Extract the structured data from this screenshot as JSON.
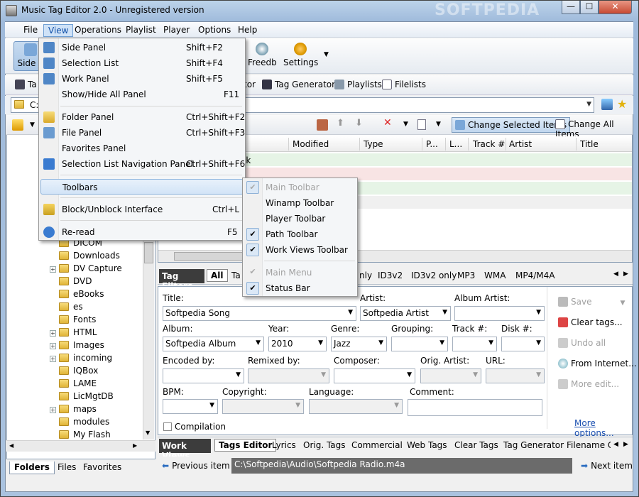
{
  "window": {
    "title": "Music Tag Editor 2.0 - Unregistered version",
    "watermark": "SOFTPEDIA",
    "controls": {
      "minimize": "—",
      "maximize": "☐",
      "close": "✕"
    }
  },
  "menubar": [
    "File",
    "View",
    "Operations",
    "Playlist",
    "Player",
    "Options",
    "Help"
  ],
  "toolbar": {
    "side_panel": "Side P",
    "freedb": "Freedb",
    "settings": "Settings"
  },
  "toolbar2": {
    "ta": "Ta",
    "tor": "tor",
    "tag_generator": "Tag Generator",
    "playlists": "Playlists",
    "filelists": "Filelists"
  },
  "path": {
    "value": "C:"
  },
  "right_toolbar": {
    "change_selected": "Change Selected Items",
    "change_all": "Change All Items"
  },
  "columns": [
    "Modified",
    "Type",
    "P...",
    "L...",
    "Track #",
    "Artist",
    "Title"
  ],
  "list": {
    "partial_text": "ok"
  },
  "folders": [
    "DICOM",
    "Downloads",
    "DV Capture",
    "DVD",
    "eBooks",
    "es",
    "Fonts",
    "HTML",
    "Images",
    "incoming",
    "IQBox",
    "LAME",
    "LicMgtDB",
    "maps",
    "modules",
    "My Flash"
  ],
  "left_tabs": [
    "Folders",
    "Files",
    "Favorites"
  ],
  "filters": {
    "label": "Tag Filters",
    "tabs": [
      "All",
      "Ta",
      "nly",
      "ID3v2",
      "ID3v2 only",
      "MP3",
      "WMA",
      "MP4/M4A"
    ]
  },
  "tag_editor": {
    "title_label": "Title:",
    "title_value": "Softpedia Song",
    "artist_label": "Artist:",
    "artist_value": "Softpedia Artist",
    "album_artist_label": "Album Artist:",
    "album_label": "Album:",
    "album_value": "Softpedia Album",
    "year_label": "Year:",
    "year_value": "2010",
    "genre_label": "Genre:",
    "genre_value": "Jazz",
    "grouping_label": "Grouping:",
    "track_label": "Track #:",
    "disk_label": "Disk #:",
    "encoded_label": "Encoded by:",
    "remixed_label": "Remixed by:",
    "composer_label": "Composer:",
    "orig_artist_label": "Orig. Artist:",
    "url_label": "URL:",
    "bpm_label": "BPM:",
    "copyright_label": "Copyright:",
    "language_label": "Language:",
    "comment_label": "Comment:",
    "compilation_label": "Compilation",
    "more_options": "More options...",
    "actions": {
      "save": "Save",
      "clear_tags": "Clear tags...",
      "undo_all": "Undo all",
      "from_internet": "From Internet...",
      "more_edit": "More edit..."
    }
  },
  "work_tabs": [
    "Work Views",
    "Tags Editor",
    "Lyrics",
    "Orig. Tags",
    "Commercial",
    "Web Tags",
    "Clear Tags",
    "Tag Generator",
    "Filename G"
  ],
  "status": {
    "prev": "Previous item",
    "path": "C:\\Softpedia\\Audio\\Softpedia Radio.m4a",
    "next": "Next item"
  },
  "view_menu": {
    "items": [
      {
        "label": "Side Panel",
        "shortcut": "Shift+F2"
      },
      {
        "label": "Selection List",
        "shortcut": "Shift+F4"
      },
      {
        "label": "Work Panel",
        "shortcut": "Shift+F5"
      },
      {
        "label": "Show/Hide All Panel",
        "shortcut": "F11"
      },
      {
        "label": "Folder Panel",
        "shortcut": "Ctrl+Shift+F2"
      },
      {
        "label": "File Panel",
        "shortcut": "Ctrl+Shift+F3"
      },
      {
        "label": "Favorites Panel",
        "shortcut": ""
      },
      {
        "label": "Selection List Navigation Panel",
        "shortcut": "Ctrl+Shift+F6"
      },
      {
        "label": "Toolbars",
        "shortcut": ""
      },
      {
        "label": "Block/Unblock Interface",
        "shortcut": "Ctrl+L"
      },
      {
        "label": "Re-read",
        "shortcut": "F5"
      }
    ]
  },
  "toolbars_submenu": [
    "Main Toolbar",
    "Winamp Toolbar",
    "Player Toolbar",
    "Path Toolbar",
    "Work Views Toolbar",
    "Main Menu",
    "Status Bar"
  ],
  "colors": {
    "accent": "#3a78c6",
    "highlight": "#d2e4f7",
    "row_green": "#e6f4e6",
    "row_pink": "#f8e4e4"
  }
}
